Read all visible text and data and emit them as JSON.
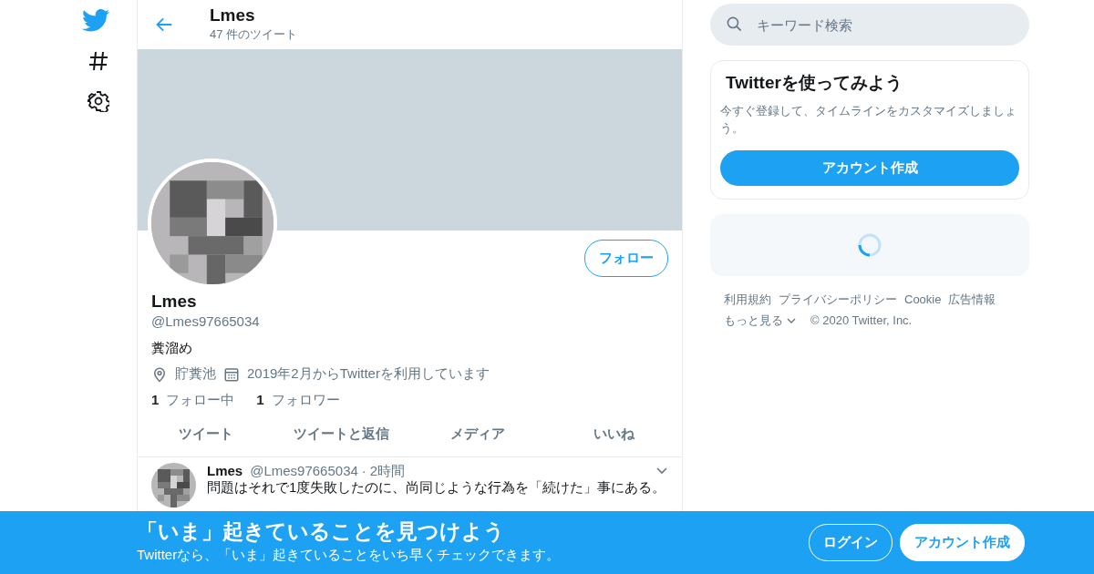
{
  "header": {
    "title": "Lmes",
    "tweet_count": "47 件のツイート"
  },
  "profile": {
    "follow_button": "フォロー",
    "name": "Lmes",
    "handle": "@Lmes97665034",
    "bio": "糞溜め",
    "location": "貯糞池",
    "joined": "2019年2月からTwitterを利用しています",
    "following_count": "1",
    "following_label": "フォロー中",
    "followers_count": "1",
    "followers_label": "フォロワー"
  },
  "tabs": [
    {
      "label": "ツイート",
      "selected": false
    },
    {
      "label": "ツイートと返信",
      "selected": false
    },
    {
      "label": "メディア",
      "selected": false
    },
    {
      "label": "いいね",
      "selected": false
    }
  ],
  "tweets": [
    {
      "name": "Lmes",
      "handle": "@Lmes97665034",
      "separator": "·",
      "time": "2時間",
      "text": "問題はそれで1度失敗したのに、尚同じような行為を「続けた」事にある。"
    }
  ],
  "search": {
    "placeholder": "キーワード検索"
  },
  "signup_card": {
    "title": "Twitterを使ってみよう",
    "text": "今すぐ登録して、タイムラインをカスタマイズしましょう。",
    "button": "アカウント作成"
  },
  "footer": {
    "links": [
      "利用規約",
      "プライバシーポリシー",
      "Cookie",
      "広告情報"
    ],
    "more": "もっと見る",
    "copyright": "© 2020 Twitter, Inc."
  },
  "bottom_bar": {
    "title": "「いま」起きていることを見つけよう",
    "text": "Twitterなら、「いま」起きていることをいち早くチェックできます。",
    "buttons": [
      {
        "label": "ログイン",
        "kind": "outline"
      },
      {
        "label": "アカウント作成",
        "kind": "filled"
      }
    ]
  }
}
